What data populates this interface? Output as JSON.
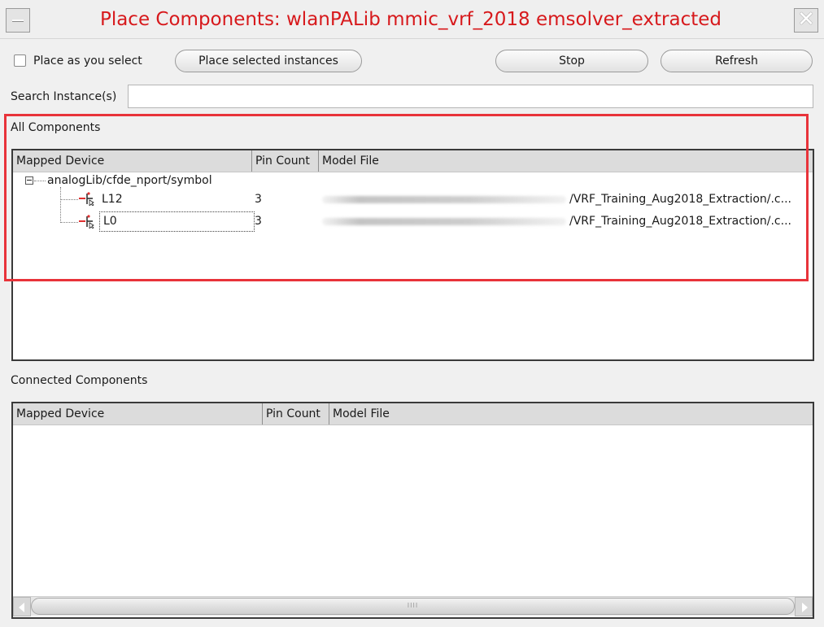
{
  "window": {
    "title": "Place Components: wlanPALib mmic_vrf_2018 emsolver_extracted",
    "close_glyph": "✕"
  },
  "toolbar": {
    "place_as_you_select_label": "Place as you select",
    "place_as_you_select_checked": false,
    "place_selected_label": "Place selected instances",
    "stop_label": "Stop",
    "refresh_label": "Refresh"
  },
  "search": {
    "label": "Search Instance(s)",
    "value": ""
  },
  "all_components": {
    "title": "All Components",
    "columns": [
      "Mapped Device",
      "Pin Count",
      "Model File"
    ],
    "group": {
      "label": "analogLib/cfde_nport/symbol",
      "expanded": true,
      "items": [
        {
          "name": "L12",
          "pin_count": "3",
          "model_file": "/VRF_Training_Aug2018_Extraction/.c..."
        },
        {
          "name": "L0",
          "pin_count": "3",
          "model_file": "/VRF_Training_Aug2018_Extraction/.c..."
        }
      ]
    }
  },
  "connected_components": {
    "title": "Connected Components",
    "columns": [
      "Mapped Device",
      "Pin Count",
      "Model File"
    ],
    "rows": []
  },
  "scrollbar": {
    "grip": "IIII"
  },
  "colors": {
    "title_text": "#d7191c",
    "highlight": "#e8333a"
  }
}
